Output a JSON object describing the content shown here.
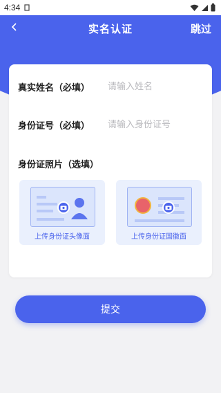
{
  "status_bar": {
    "time": "4:34"
  },
  "nav": {
    "title": "实名认证",
    "skip_label": "跳过"
  },
  "form": {
    "name": {
      "label": "真实姓名（必填）",
      "placeholder": "请输入姓名",
      "value": ""
    },
    "id_number": {
      "label": "身份证号（必填）",
      "placeholder": "请输入身份证号",
      "value": ""
    },
    "photo_section_label": "身份证照片（选填）",
    "upload_front_label": "上传身份证头像面",
    "upload_back_label": "上传身份证国徽面"
  },
  "submit_label": "提交",
  "colors": {
    "accent": "#4a63ec",
    "upload_bg": "#eaf0fd"
  }
}
